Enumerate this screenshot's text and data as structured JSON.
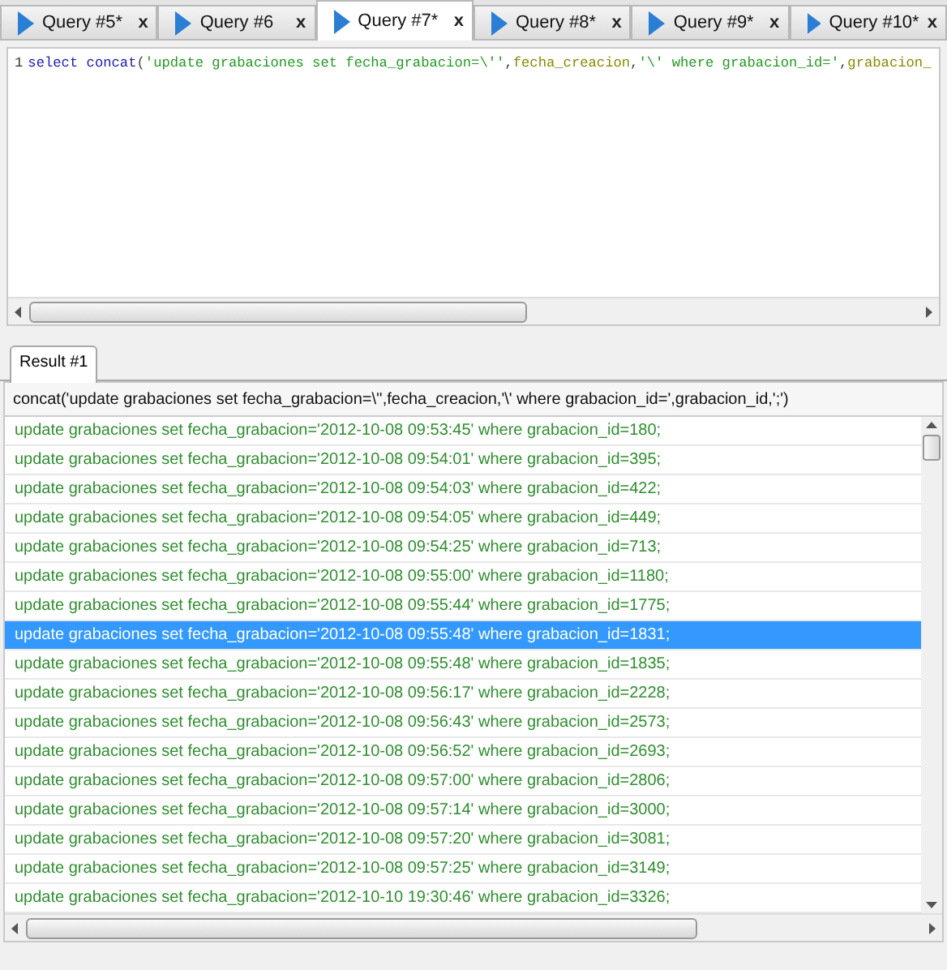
{
  "tabs": [
    {
      "label": "Query #5*",
      "close": "x",
      "selected": false
    },
    {
      "label": "Query #6",
      "close": "x",
      "selected": false
    },
    {
      "label": "Query #7*",
      "close": "x",
      "selected": true
    },
    {
      "label": "Query #8*",
      "close": "x",
      "selected": false
    },
    {
      "label": "Query #9*",
      "close": "x",
      "selected": false
    },
    {
      "label": "Query #10*",
      "close": "x",
      "selected": false
    }
  ],
  "editor": {
    "line_number": "1",
    "tokens": [
      {
        "kind": "keyword",
        "text": "select "
      },
      {
        "kind": "keyword",
        "text": "concat"
      },
      {
        "kind": "punct",
        "text": "("
      },
      {
        "kind": "string",
        "text": "'update grabaciones set fecha_grabacion=\\''"
      },
      {
        "kind": "punct",
        "text": ","
      },
      {
        "kind": "identifier",
        "text": "fecha_creacion"
      },
      {
        "kind": "punct",
        "text": ","
      },
      {
        "kind": "string",
        "text": "'\\' where grabacion_id='"
      },
      {
        "kind": "punct",
        "text": ","
      },
      {
        "kind": "identifier",
        "text": "grabacion_"
      }
    ]
  },
  "result_tabs": [
    {
      "label": "Result #1",
      "selected": true
    }
  ],
  "result": {
    "column": "concat('update grabaciones set fecha_grabacion=\\'',fecha_creacion,'\\' where grabacion_id=',grabacion_id,';')",
    "rows": [
      {
        "text": "update grabaciones set fecha_grabacion='2012-10-08 09:53:45' where grabacion_id=180;",
        "selected": false
      },
      {
        "text": "update grabaciones set fecha_grabacion='2012-10-08 09:54:01' where grabacion_id=395;",
        "selected": false
      },
      {
        "text": "update grabaciones set fecha_grabacion='2012-10-08 09:54:03' where grabacion_id=422;",
        "selected": false
      },
      {
        "text": "update grabaciones set fecha_grabacion='2012-10-08 09:54:05' where grabacion_id=449;",
        "selected": false
      },
      {
        "text": "update grabaciones set fecha_grabacion='2012-10-08 09:54:25' where grabacion_id=713;",
        "selected": false
      },
      {
        "text": "update grabaciones set fecha_grabacion='2012-10-08 09:55:00' where grabacion_id=1180;",
        "selected": false
      },
      {
        "text": "update grabaciones set fecha_grabacion='2012-10-08 09:55:44' where grabacion_id=1775;",
        "selected": false
      },
      {
        "text": "update grabaciones set fecha_grabacion='2012-10-08 09:55:48' where grabacion_id=1831;",
        "selected": true
      },
      {
        "text": "update grabaciones set fecha_grabacion='2012-10-08 09:55:48' where grabacion_id=1835;",
        "selected": false
      },
      {
        "text": "update grabaciones set fecha_grabacion='2012-10-08 09:56:17' where grabacion_id=2228;",
        "selected": false
      },
      {
        "text": "update grabaciones set fecha_grabacion='2012-10-08 09:56:43' where grabacion_id=2573;",
        "selected": false
      },
      {
        "text": "update grabaciones set fecha_grabacion='2012-10-08 09:56:52' where grabacion_id=2693;",
        "selected": false
      },
      {
        "text": "update grabaciones set fecha_grabacion='2012-10-08 09:57:00' where grabacion_id=2806;",
        "selected": false
      },
      {
        "text": "update grabaciones set fecha_grabacion='2012-10-08 09:57:14' where grabacion_id=3000;",
        "selected": false
      },
      {
        "text": "update grabaciones set fecha_grabacion='2012-10-08 09:57:20' where grabacion_id=3081;",
        "selected": false
      },
      {
        "text": "update grabaciones set fecha_grabacion='2012-10-08 09:57:25' where grabacion_id=3149;",
        "selected": false
      },
      {
        "text": "update grabaciones set fecha_grabacion='2012-10-10 19:30:46' where grabacion_id=3326;",
        "selected": false
      }
    ]
  }
}
